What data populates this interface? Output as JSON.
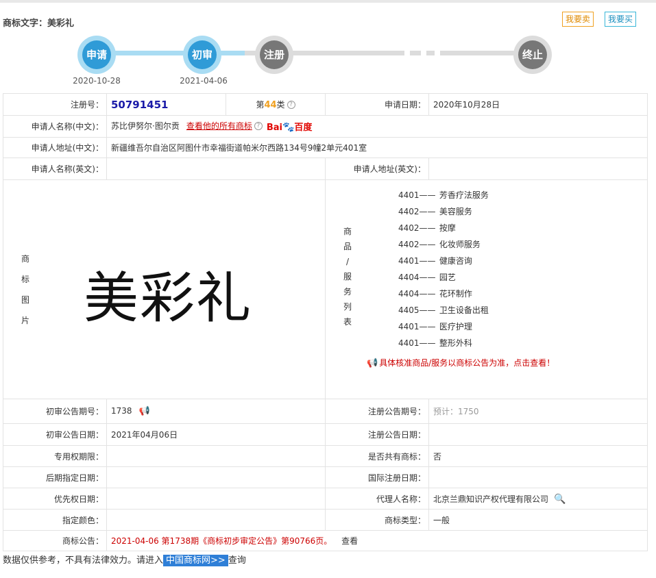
{
  "header": {
    "title": "商标文字：美彩礼",
    "sell_button": "我要卖",
    "buy_button": "我要买"
  },
  "progress": {
    "steps": [
      {
        "label": "申请",
        "date": "2020-10-28",
        "state": "active"
      },
      {
        "label": "初审",
        "date": "2021-04-06",
        "state": "active"
      },
      {
        "label": "注册",
        "date": "",
        "state": "inactive"
      },
      {
        "label": "终止",
        "date": "",
        "state": "inactive"
      }
    ],
    "colors": {
      "active": "#2f9bd7",
      "active_ring": "#a9dcf3",
      "inactive": "#777777",
      "inactive_ring": "#dcdcdc"
    }
  },
  "table": {
    "reg_no_label": "注册号：",
    "reg_no": "50791451",
    "class_prefix": "第",
    "class_num": "44",
    "class_suffix": "类",
    "apply_date_label": "申请日期：",
    "apply_date": "2020年10月28日",
    "applicant_cn_label": "申请人名称(中文)：",
    "applicant_cn": "苏比伊努尔·图尔贡",
    "all_marks_link": "查看他的所有商标",
    "baidu_text": "Bai",
    "baidu_suffix": "百度",
    "address_cn_label": "申请人地址(中文)：",
    "address_cn": "新疆维吾尔自治区阿图什市幸福街道帕米尔西路134号9幢2单元401室",
    "applicant_en_label": "申请人名称(英文)：",
    "address_en_label": "申请人地址(英文)：",
    "mark_image_label": [
      "商",
      "标",
      "图",
      "片"
    ],
    "mark_image_text": "美彩礼",
    "goods_label": [
      "商",
      "品",
      "/",
      "服",
      "务",
      "列",
      "表"
    ],
    "goods": [
      {
        "code": "4401——",
        "name": "芳香疗法服务"
      },
      {
        "code": "4402——",
        "name": "美容服务"
      },
      {
        "code": "4402——",
        "name": "按摩"
      },
      {
        "code": "4402——",
        "name": "化妆师服务"
      },
      {
        "code": "4401——",
        "name": "健康咨询"
      },
      {
        "code": "4404——",
        "name": "园艺"
      },
      {
        "code": "4404——",
        "name": "花环制作"
      },
      {
        "code": "4405——",
        "name": "卫生设备出租"
      },
      {
        "code": "4401——",
        "name": "医疗护理"
      },
      {
        "code": "4401——",
        "name": "整形外科"
      }
    ],
    "goods_notice": "具体核准商品/服务以商标公告为准，点击查看！",
    "prelim_no_label": "初审公告期号：",
    "prelim_no": "1738",
    "reg_pub_no_label": "注册公告期号：",
    "reg_pub_no": "预计：1750",
    "prelim_date_label": "初审公告日期：",
    "prelim_date": "2021年04月06日",
    "reg_pub_date_label": "注册公告日期：",
    "exclusive_label": "专用权期限：",
    "shared_label": "是否共有商标：",
    "shared": "否",
    "later_label": "后期指定日期：",
    "intl_label": "国际注册日期：",
    "priority_label": "优先权日期：",
    "agent_label": "代理人名称：",
    "agent": "北京兰鼎知识产权代理有限公司",
    "color_label": "指定颜色：",
    "type_label": "商标类型：",
    "type": "一般",
    "announce_label": "商标公告：",
    "announce": "2021-04-06 第1738期《商标初步审定公告》第90766页。",
    "announce_view": "查看"
  },
  "footer": {
    "text": "数据仅供参考，不具有法律效力。请进入",
    "link": "中国商标网>>",
    "suffix": "查询"
  }
}
